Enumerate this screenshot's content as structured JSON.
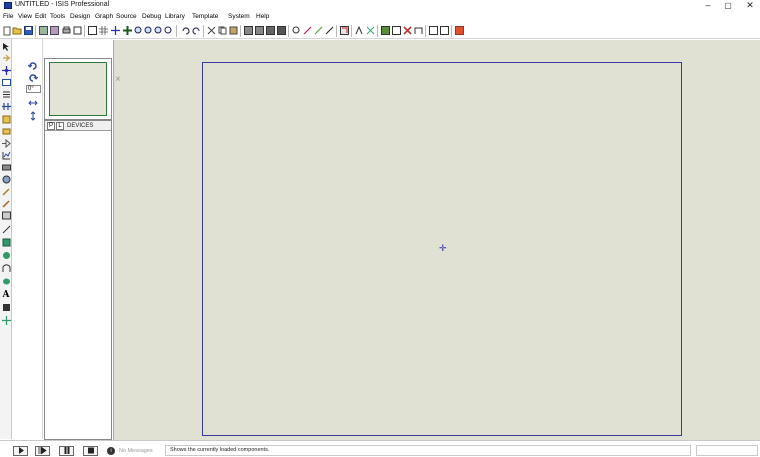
{
  "window": {
    "title": "UNTITLED - ISIS Professional",
    "minimize": "–",
    "maximize": "▢",
    "close": "✕"
  },
  "menu": [
    "File",
    "View",
    "Edit",
    "Tools",
    "Design",
    "Graph",
    "Source",
    "Debug",
    "Library",
    "Template",
    "System",
    "Help"
  ],
  "panel": {
    "p_button": "P",
    "l_button": "L",
    "devices_label": "DEVICES",
    "angle_value": "0°"
  },
  "status": {
    "no_messages": "No Messages",
    "hint": "Shows the currently loaded components."
  },
  "colors": {
    "canvas": "#e0e0d3",
    "sheet_border": "#3a3aa0",
    "overview_border": "#2f7a3a"
  }
}
